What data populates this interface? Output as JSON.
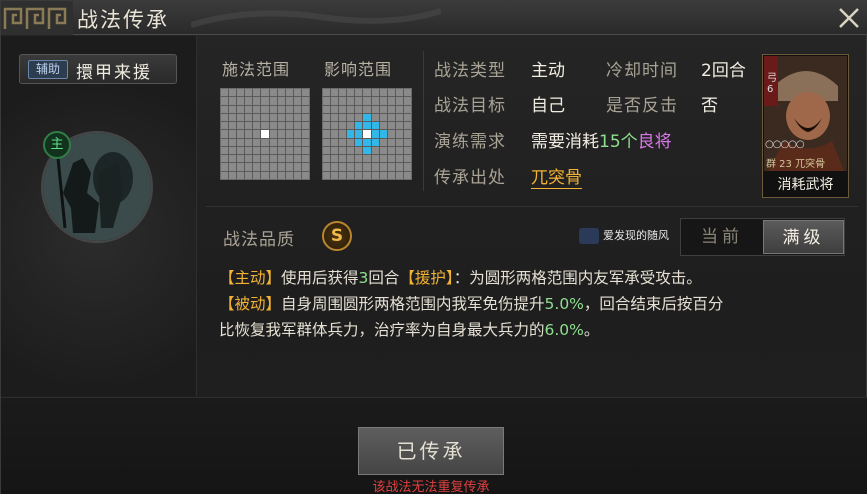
{
  "window": {
    "title": "战法传承"
  },
  "skill": {
    "type_badge": "辅助",
    "name": "擐甲来援"
  },
  "portrait": {
    "role_mark": "主"
  },
  "ranges": {
    "cast_label": "施法范围",
    "effect_label": "影响范围",
    "grid_size": 11,
    "cast_cells": [
      [
        5,
        5
      ]
    ],
    "effect_cells": [
      [
        3,
        5
      ],
      [
        4,
        4
      ],
      [
        4,
        5
      ],
      [
        4,
        6
      ],
      [
        5,
        3
      ],
      [
        5,
        4
      ],
      [
        5,
        6
      ],
      [
        5,
        7
      ],
      [
        6,
        4
      ],
      [
        6,
        5
      ],
      [
        6,
        6
      ],
      [
        7,
        5
      ]
    ]
  },
  "info": {
    "type_label": "战法类型",
    "type_value": "主动",
    "cooldown_label": "冷却时间",
    "cooldown_value": "2回合",
    "target_label": "战法目标",
    "target_value": "自己",
    "counter_label": "是否反击",
    "counter_value": "否",
    "drill_label": "演练需求",
    "drill_prefix": "需要消耗",
    "drill_count": "15个",
    "drill_item": "良将",
    "origin_label": "传承出处",
    "origin_value": "兀突骨"
  },
  "card": {
    "tag": "弓\n6",
    "stars": "○○○○○",
    "level": "群 23 兀突骨",
    "caption": "消耗武将"
  },
  "quality": {
    "label": "战法品质",
    "grade": "S"
  },
  "watermark": {
    "text": "爱发现的随风"
  },
  "toggle": {
    "current": "当前",
    "max": "满级",
    "selected": "max"
  },
  "description": {
    "line1_tag": "【主动】",
    "line1_a": "使用后获得",
    "line1_num": "3",
    "line1_b": "回合",
    "line1_tag2": "【援护】",
    "line1_c": "：为圆形两格范围内友军承受攻击。",
    "line2_tag": "【被动】",
    "line2_a": "自身周围圆形两格范围内我军免伤提升",
    "line2_num": "5.0%",
    "line2_b": "，回合结束后按百分",
    "line3_a": "比恢复我军群体兵力，治疗率为自身最大兵力的",
    "line3_num": "6.0%",
    "line3_b": "。"
  },
  "footer": {
    "button_label": "已传承",
    "warning": "该战法无法重复传承"
  },
  "colors": {
    "accent_orange": "#f2b233",
    "effect_cyan": "#33b7e8",
    "quality_purple": "#d879ea",
    "warning_red": "#e04040"
  }
}
